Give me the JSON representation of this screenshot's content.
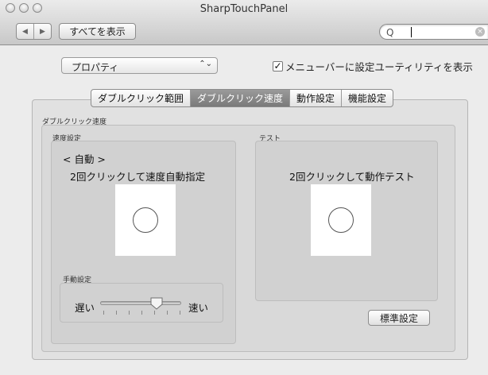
{
  "window": {
    "title": "SharpTouchPanel"
  },
  "toolbar": {
    "back_icon": "◀",
    "forward_icon": "▶",
    "show_all_label": "すべてを表示",
    "search": {
      "value": "",
      "magnifier_icon": "Q",
      "clear_icon": "×"
    }
  },
  "top": {
    "popup_value": "プロパティ",
    "popup_arrows": "⌃⌄",
    "menu_checkbox": {
      "checked": true,
      "mark": "✓",
      "label": "メニューバーに設定ユーティリティを表示"
    }
  },
  "tabs": [
    {
      "label": "ダブルクリック範囲",
      "active": false
    },
    {
      "label": "ダブルクリック速度",
      "active": true
    },
    {
      "label": "動作設定",
      "active": false
    },
    {
      "label": "機能設定",
      "active": false
    }
  ],
  "panel": {
    "group_title": "ダブルクリック速度",
    "speed": {
      "title": "速度設定",
      "mode": "< 自動 >",
      "instruction": "2回クリックして速度自動指定",
      "manual_title": "手動設定",
      "slow_label": "遅い",
      "fast_label": "速い",
      "slider_value_fraction": 0.7,
      "tick_count": 7
    },
    "test": {
      "title": "テスト",
      "instruction": "2回クリックして動作テスト"
    },
    "default_button": "標準設定"
  }
}
